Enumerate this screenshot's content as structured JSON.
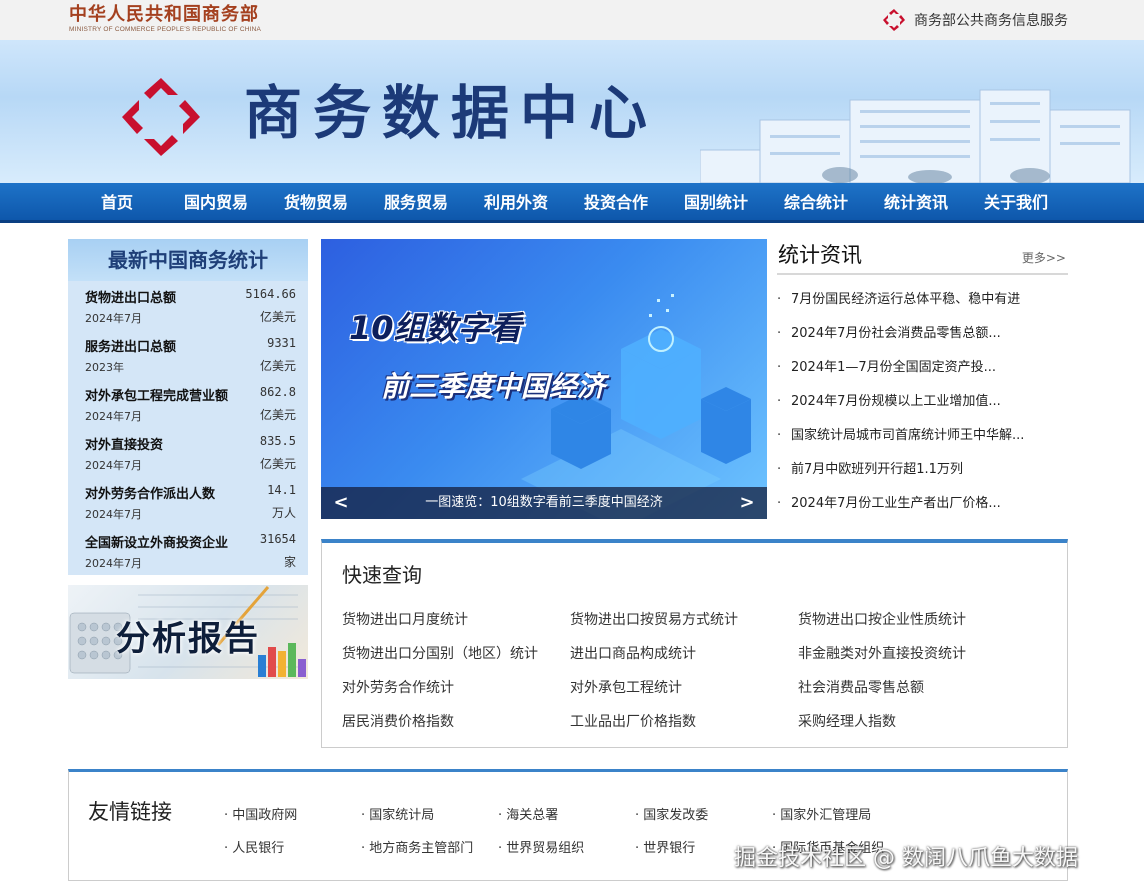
{
  "header": {
    "ministry_cn": "中华人民共和国商务部",
    "ministry_en": "MINISTRY OF COMMERCE PEOPLE'S REPUBLIC OF CHINA",
    "service_link": "商务部公共商务信息服务",
    "brand_red": "#c8102e"
  },
  "banner": {
    "title": "商务数据中心"
  },
  "nav": [
    "首页",
    "国内贸易",
    "货物贸易",
    "服务贸易",
    "利用外资",
    "投资合作",
    "国别统计",
    "综合统计",
    "统计资讯",
    "关于我们"
  ],
  "stats": {
    "title": "最新中国商务统计",
    "rows": [
      {
        "name": "货物进出口总额",
        "value": "5164.66",
        "date": "2024年7月",
        "unit": "亿美元"
      },
      {
        "name": "服务进出口总额",
        "value": "9331",
        "date": "2023年",
        "unit": "亿美元"
      },
      {
        "name": "对外承包工程完成营业额",
        "value": "862.8",
        "date": "2024年7月",
        "unit": "亿美元"
      },
      {
        "name": "对外直接投资",
        "value": "835.5",
        "date": "2024年7月",
        "unit": "亿美元"
      },
      {
        "name": "对外劳务合作派出人数",
        "value": "14.1",
        "date": "2024年7月",
        "unit": "万人"
      },
      {
        "name": "全国新设立外商投资企业",
        "value": "31654",
        "date": "2024年7月",
        "unit": "家"
      }
    ]
  },
  "report": {
    "title": "分析报告"
  },
  "carousel": {
    "line1": "10组数字看",
    "line2": "前三季度中国经济",
    "caption": "一图速览：10组数字看前三季度中国经济",
    "prev": "<",
    "next": ">"
  },
  "news": {
    "title": "统计资讯",
    "more": "更多>>",
    "items": [
      "7月份国民经济运行总体平稳、稳中有进",
      "2024年7月份社会消费品零售总额...",
      "2024年1—7月份全国固定资产投...",
      "2024年7月份规模以上工业增加值...",
      "国家统计局城市司首席统计师王中华解...",
      "前7月中欧班列开行超1.1万列",
      "2024年7月份工业生产者出厂价格..."
    ]
  },
  "quick": {
    "title": "快速查询",
    "links": [
      "货物进出口月度统计",
      "货物进出口按贸易方式统计",
      "货物进出口按企业性质统计",
      "货物进出口分国别（地区）统计",
      "进出口商品构成统计",
      "非金融类对外直接投资统计",
      "对外劳务合作统计",
      "对外承包工程统计",
      "社会消费品零售总额",
      "居民消费价格指数",
      "工业品出厂价格指数",
      "采购经理人指数"
    ]
  },
  "links": {
    "title": "友情链接",
    "items": [
      "中国政府网",
      "国家统计局",
      "海关总署",
      "国家发改委",
      "国家外汇管理局",
      "人民银行",
      "地方商务主管部门",
      "世界贸易组织",
      "世界银行",
      "国际货币基金组织"
    ]
  },
  "watermark": "掘金技术社区 @ 数阔八爪鱼大数据"
}
